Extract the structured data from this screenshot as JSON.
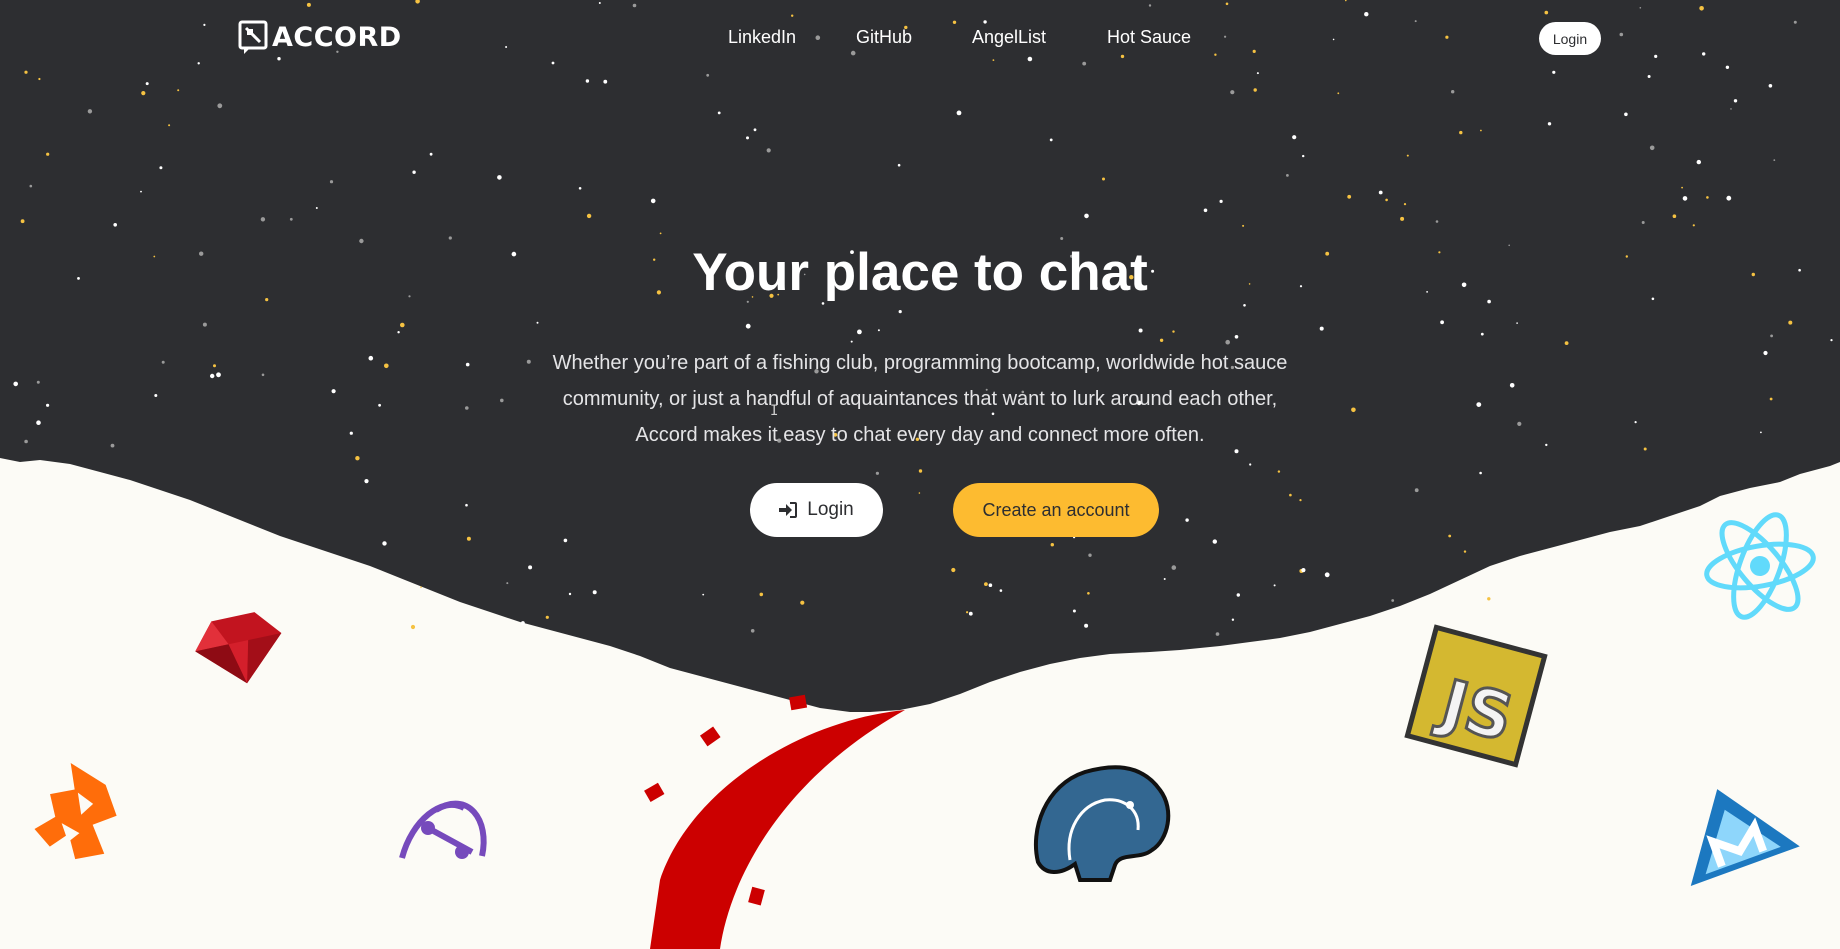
{
  "nav": {
    "brand": "ACCORD",
    "links": [
      "LinkedIn",
      "GitHub",
      "AngelList",
      "Hot Sauce"
    ],
    "login_label": "Login"
  },
  "hero": {
    "title": "Your place to chat",
    "description": "Whether you’re part of a fishing club, programming bootcamp, worldwide hot sauce community, or just a handful of aquaintances that want to lurk around each other, Accord makes it easy to chat every day and connect more often.",
    "login_label": "Login",
    "create_label": "Create an account"
  },
  "colors": {
    "night": "#2d2e31",
    "paper": "#fcfbf6",
    "accent": "#fdbb30",
    "star": "#f5c242"
  },
  "icons": [
    "ruby-icon",
    "rails-icon",
    "postgresql-icon",
    "javascript-icon",
    "react-icon",
    "webpack-icon",
    "redux-icon",
    "heroku-icon"
  ]
}
